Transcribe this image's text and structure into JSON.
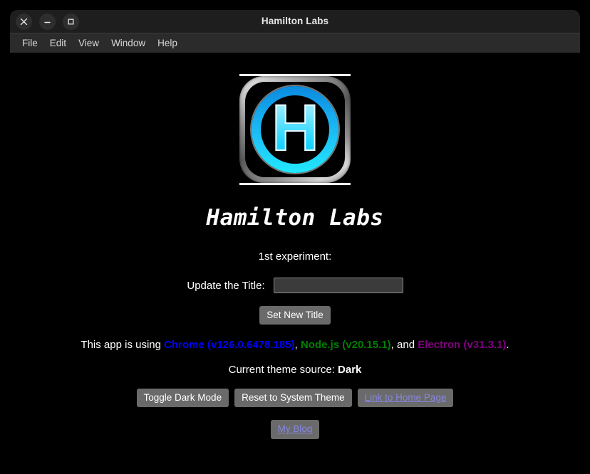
{
  "window": {
    "title": "Hamilton Labs",
    "controls": [
      {
        "name": "close",
        "glyph": "close-icon",
        "label": "Close"
      },
      {
        "name": "minimize",
        "glyph": "minimize-icon",
        "label": "Minimize"
      },
      {
        "name": "maximize",
        "glyph": "maximize-icon",
        "label": "Maximize"
      }
    ]
  },
  "menubar": {
    "items": [
      {
        "label": "File"
      },
      {
        "label": "Edit"
      },
      {
        "label": "View"
      },
      {
        "label": "Window"
      },
      {
        "label": "Help"
      }
    ]
  },
  "logo": {
    "name": "hamilton-labs-logo",
    "letter": "H",
    "colors": {
      "border": "#8d8d8d",
      "ring_top": "#0a8ae0",
      "ring_bottom": "#22e8ff",
      "letter": "#19d4ff",
      "background": "#000000"
    }
  },
  "main": {
    "headline": "Hamilton Labs",
    "experiment_label": "1st experiment:",
    "title_field": {
      "label": "Update the Title:",
      "value": "",
      "placeholder": ""
    },
    "set_title_button": "Set New Title",
    "versions": {
      "prefix": "This app is using ",
      "chrome": "Chrome (v126.0.6478.185)",
      "sep1": ", ",
      "node": "Node.js (v20.15.1)",
      "sep2": ", and ",
      "electron": "Electron (v31.3.1)",
      "suffix": ".",
      "colors": {
        "chrome": "#0000ff",
        "node": "#008000",
        "electron": "#800080"
      }
    },
    "theme": {
      "label": "Current theme source: ",
      "value": "Dark"
    },
    "buttons": {
      "toggle_dark_mode": "Toggle Dark Mode",
      "reset_system_theme": "Reset to System Theme",
      "link_home_page": "Link to Home Page",
      "my_blog": "My Blog"
    }
  }
}
